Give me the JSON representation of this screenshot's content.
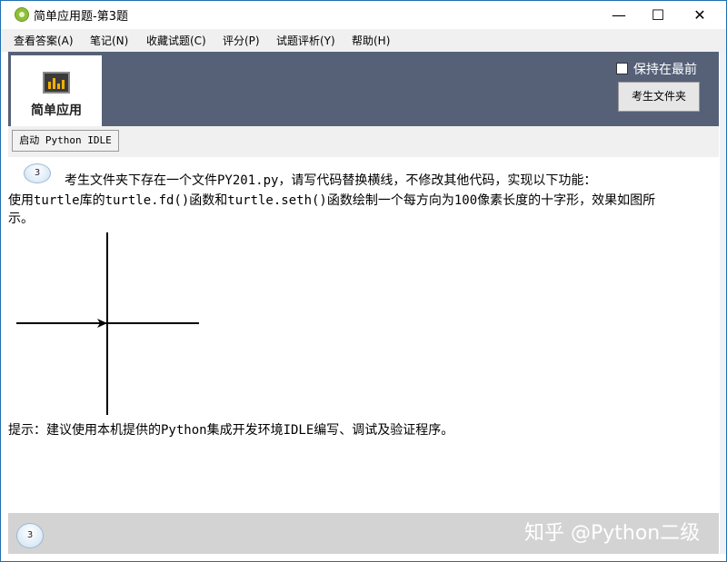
{
  "window": {
    "title": "简单应用题-第3题",
    "controls": {
      "minimize": "—",
      "maximize": "☐",
      "close": "✕"
    }
  },
  "menu": [
    {
      "label": "查看答案(A)"
    },
    {
      "label": "笔记(N)"
    },
    {
      "label": "收藏试题(C)"
    },
    {
      "label": "评分(P)"
    },
    {
      "label": "试题评析(Y)"
    },
    {
      "label": "帮助(H)"
    }
  ],
  "header": {
    "tile_label": "简单应用",
    "tile_icon": "chart-icon",
    "keep_on_top_label": "保持在最前",
    "keep_on_top_checked": false,
    "exam_folder_button": "考生文件夹",
    "colors": {
      "header_bg": "#566178",
      "bottom_bg": "#d3d3d3"
    }
  },
  "toolbar": {
    "launch_idle_button": "启动 Python IDLE"
  },
  "question": {
    "badge_top": "3",
    "line1": "考生文件夹下存在一个文件PY201.py，请写代码替换横线，不修改其他代码，实现以下功能：",
    "line2": "使用turtle库的turtle.fd()函数和turtle.seth()函数绘制一个每方向为100像素长度的十字形，效果如图所",
    "line3": "示。",
    "hint": "提示：建议使用本机提供的Python集成开发环境IDLE编写、调试及验证程序。"
  },
  "footer": {
    "badge_bottom": "3",
    "watermark": "知乎 @Python二级"
  }
}
